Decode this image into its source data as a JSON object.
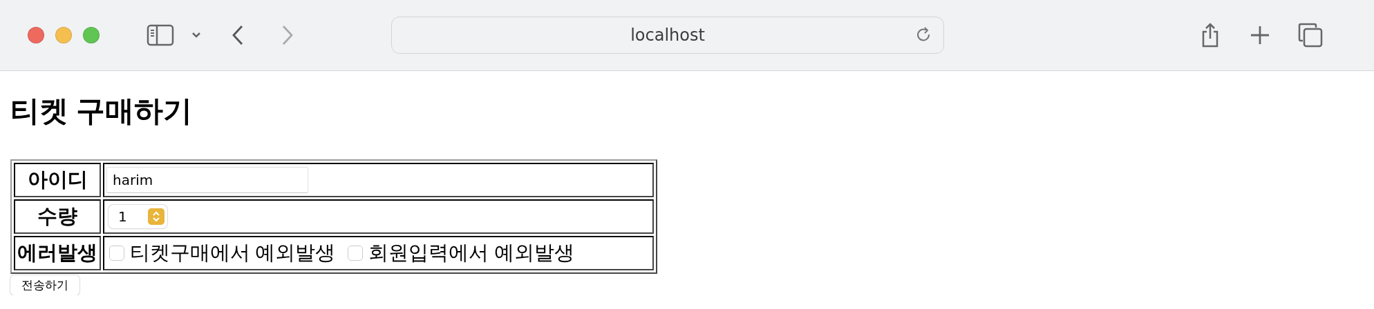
{
  "browser": {
    "address": "localhost"
  },
  "heading": "티켓 구매하기",
  "form": {
    "rows": [
      {
        "label": "아이디",
        "kind": "text",
        "value": "harim"
      },
      {
        "label": "수량",
        "kind": "select",
        "value": "1"
      },
      {
        "label": "에러발생",
        "kind": "checkboxes",
        "options": [
          {
            "label": "티켓구매에서 예외발생",
            "checked": false
          },
          {
            "label": "회원입력에서 예외발생",
            "checked": false
          }
        ]
      }
    ],
    "submit": "전송하기"
  }
}
